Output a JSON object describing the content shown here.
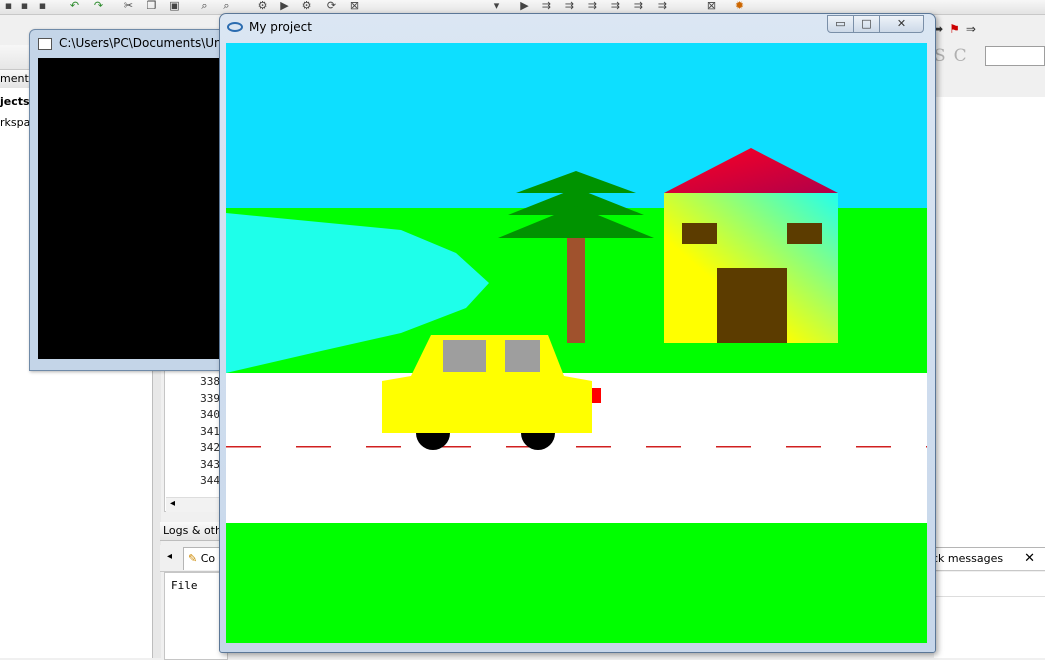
{
  "ide": {
    "management_label": "ment",
    "projects_label": "jects",
    "workspace_label": "rkspa",
    "line_numbers": [
      "338",
      "339",
      "340",
      "341",
      "342",
      "343",
      "344"
    ],
    "logs_label": "Logs & othe",
    "logs_tab_label": "Co",
    "logs_file_column": "File",
    "build_messages_tab": "ck messages",
    "close_glyph": "✕"
  },
  "console_window": {
    "title": "C:\\Users\\PC\\Documents\\Untit"
  },
  "project_window": {
    "title": "My project",
    "minimize_glyph": "▭",
    "maximize_glyph": "□",
    "close_glyph": "✕"
  },
  "scene_colors": {
    "sky": "#0ddfff",
    "grass": "#00ff00",
    "lake": "#1effea",
    "road": "#ffffff",
    "lane_marking": "#d11f1f",
    "tree_leaves": "#009300",
    "tree_trunk": "#a0522d",
    "roof_light": "#ff0022",
    "roof_dark": "#b0004a",
    "house_wall_yellow": "#ffff00",
    "house_wall_cyan": "#22ffee",
    "house_door_windows": "#5c3c00",
    "car_body": "#ffff00",
    "car_windows": "#9e9e9e",
    "car_tail_light": "#ff0000",
    "car_wheels": "#000000"
  }
}
